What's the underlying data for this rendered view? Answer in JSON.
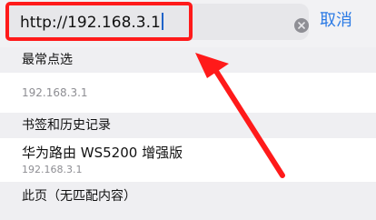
{
  "address_bar": {
    "url": "http://192.168.3.1",
    "cancel_label": "取消"
  },
  "sections": {
    "frequent": {
      "header": "最常点选",
      "items": [
        {
          "url": "192.168.3.1"
        }
      ]
    },
    "bookmarks_history": {
      "header": "书签和历史记录",
      "items": [
        {
          "title": "华为路由 WS5200 增强版",
          "url": "192.168.3.1"
        }
      ]
    },
    "on_this_page": {
      "header": "此页（无匹配内容）"
    }
  },
  "annotation": {
    "color": "#ff1a1a"
  }
}
